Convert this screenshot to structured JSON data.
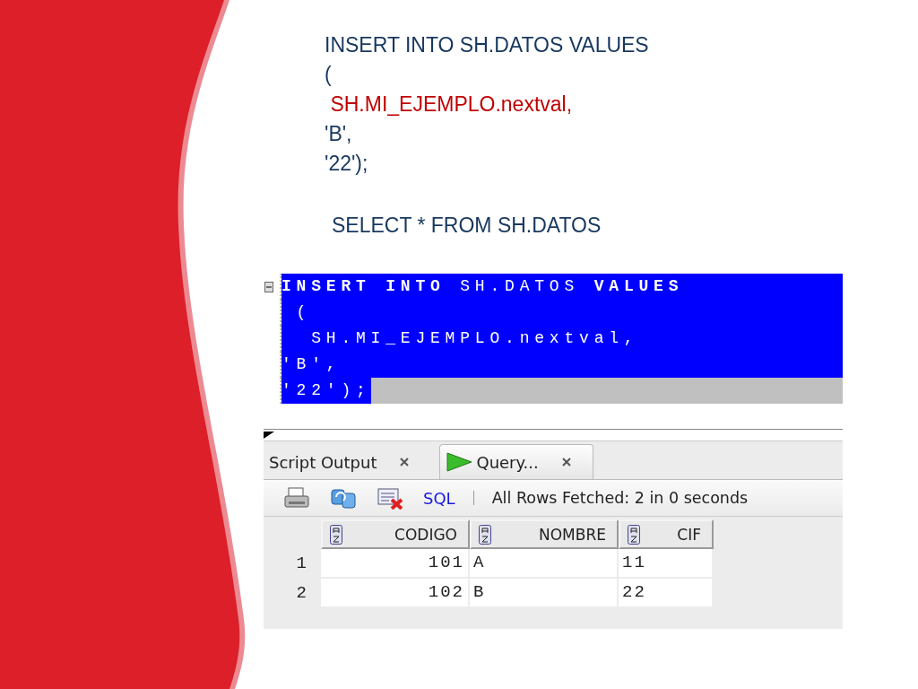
{
  "slide": {
    "lines": [
      {
        "text": "INSERT INTO SH.DATOS VALUES",
        "kind": "plain"
      },
      {
        "text": "(",
        "kind": "plain"
      },
      {
        "text": " SH.MI_EJEMPLO.nextval,",
        "kind": "highlight"
      },
      {
        "text": "'B',",
        "kind": "plain"
      },
      {
        "text": "'22');",
        "kind": "plain"
      }
    ],
    "query": "SELECT * FROM SH.DATOS"
  },
  "editor": {
    "lines": [
      {
        "text": "**INSERT** **INTO** SH.DATOS **VALUES**",
        "selected": true
      },
      {
        "text": " (",
        "selected": true
      },
      {
        "text": "  SH.MI_EJEMPLO.nextval,",
        "selected": true
      },
      {
        "text": "'B',",
        "selected": true
      },
      {
        "text": "'22');",
        "selected": true
      }
    ]
  },
  "tabs": [
    {
      "label": "Script Output",
      "kind": "output",
      "selected": false
    },
    {
      "label": "Query...",
      "kind": "query",
      "selected": true
    }
  ],
  "toolbar": {
    "sql_link": "SQL",
    "status": "All Rows Fetched: 2 in 0 seconds"
  },
  "grid": {
    "columns": [
      "CODIGO",
      "NOMBRE",
      "CIF"
    ],
    "rows": [
      {
        "number": "1",
        "cells": [
          "101",
          "A",
          "11"
        ]
      },
      {
        "number": "2",
        "cells": [
          "102",
          "B",
          "22"
        ]
      }
    ]
  }
}
